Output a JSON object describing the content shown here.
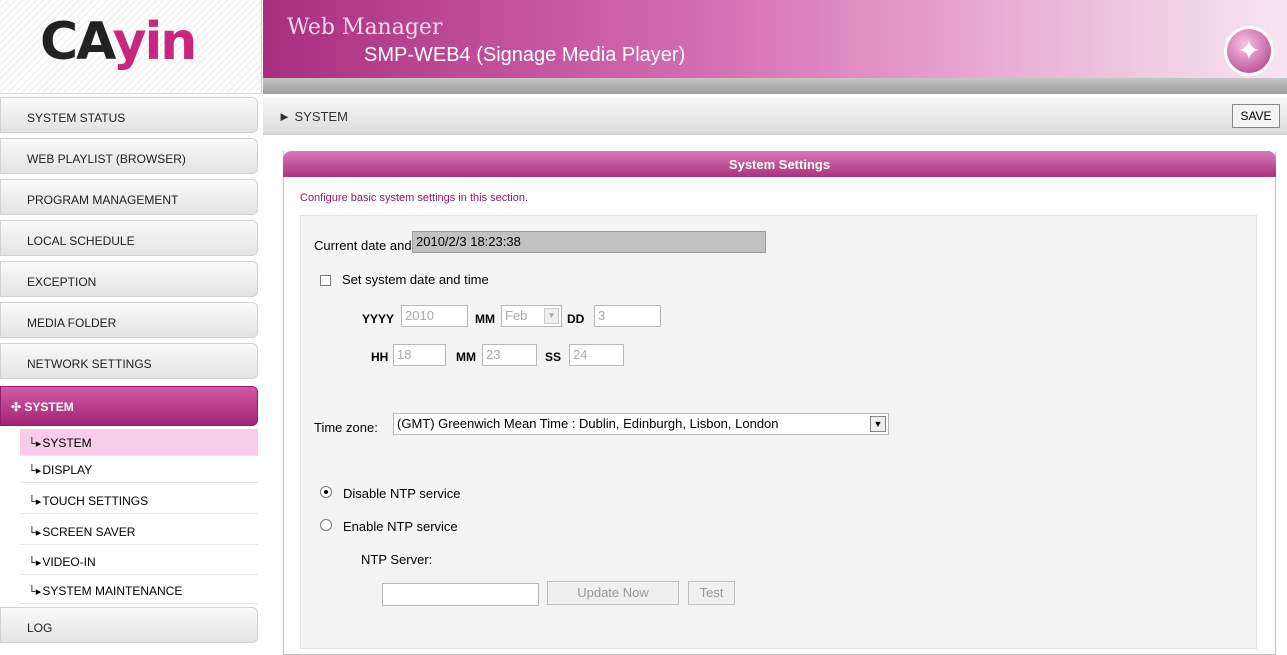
{
  "logo": {
    "text_part1": "CA",
    "text_part2": "yin"
  },
  "header": {
    "title": "Web Manager",
    "subtitle": "SMP-WEB4 (Signage Media Player)",
    "icon": "magic-wand-icon"
  },
  "toolbar": {
    "breadcrumb": "► SYSTEM",
    "save_label": "SAVE"
  },
  "sidebar": {
    "items": [
      {
        "label": "SYSTEM STATUS"
      },
      {
        "label": "WEB PLAYLIST (BROWSER)"
      },
      {
        "label": "PROGRAM MANAGEMENT"
      },
      {
        "label": "LOCAL SCHEDULE"
      },
      {
        "label": "EXCEPTION"
      },
      {
        "label": "MEDIA FOLDER"
      },
      {
        "label": "NETWORK SETTINGS"
      },
      {
        "label": "✣ SYSTEM"
      },
      {
        "label": "LOG"
      }
    ],
    "subitems": [
      {
        "label": "SYSTEM"
      },
      {
        "label": "DISPLAY"
      },
      {
        "label": "TOUCH SETTINGS"
      },
      {
        "label": "SCREEN SAVER"
      },
      {
        "label": "VIDEO-IN"
      },
      {
        "label": "SYSTEM MAINTENANCE"
      }
    ]
  },
  "panel": {
    "title": "System Settings",
    "description": "Configure basic system settings in this section.",
    "current_label": "Current date and time",
    "current_value": "2010/2/3   18:23:38",
    "set_checkbox_label": "Set system date and time",
    "yyyy_label": "YYYY",
    "yyyy_value": "2010",
    "month_label": "MM",
    "month_value": "Feb",
    "dd_label": "DD",
    "dd_value": "3",
    "hh_label": "HH",
    "hh_value": "18",
    "min_label": "MM",
    "min_value": "23",
    "ss_label": "SS",
    "ss_value": "24",
    "timezone_label": "Time zone:",
    "timezone_value": "(GMT) Greenwich Mean Time : Dublin, Edinburgh, Lisbon, London",
    "disable_ntp_label": "Disable NTP service",
    "enable_ntp_label": "Enable NTP service",
    "ntp_server_label": "NTP Server:",
    "ntp_server_value": "",
    "update_label": "Update Now",
    "test_label": "Test"
  },
  "colors": {
    "accent": "#b03584",
    "selected_sub": "#f9cdea"
  }
}
